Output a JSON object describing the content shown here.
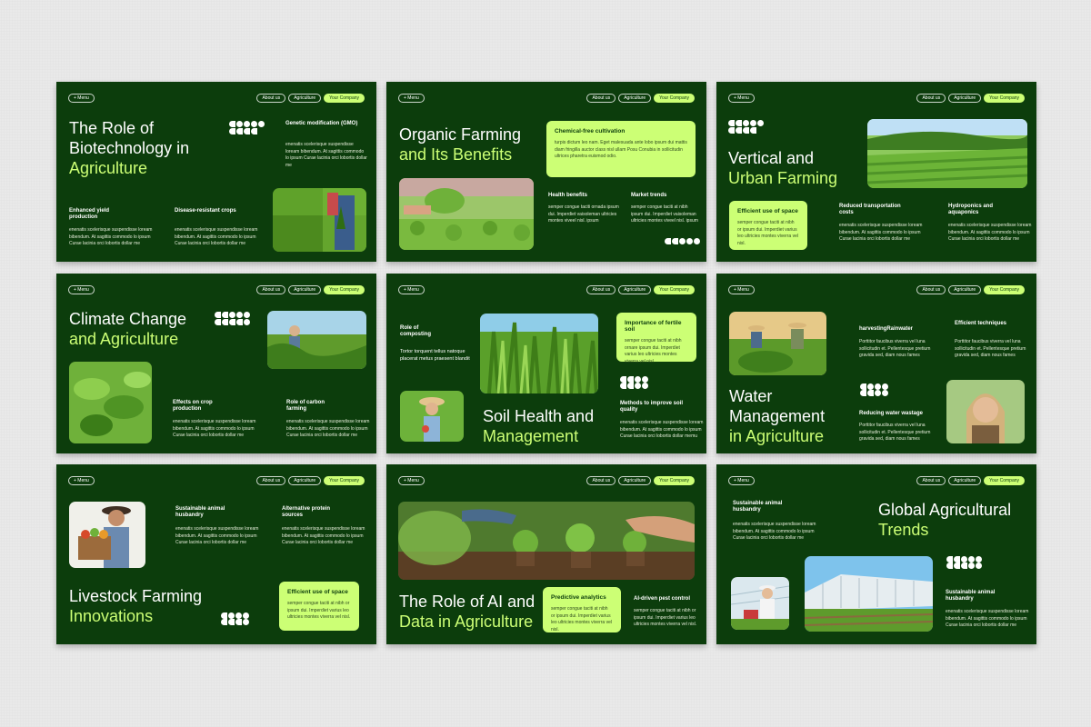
{
  "common": {
    "menu": "+ Menu",
    "nav": [
      "About us",
      "Agriculture",
      "Your Company"
    ]
  },
  "colors": {
    "slide_bg": "#0c3d0c",
    "accent": "#ccff75",
    "page_bg": "#e9e9e9"
  },
  "slides": [
    {
      "title": [
        "The Role of",
        "Biotechnology in"
      ],
      "title_accent": [
        "Agriculture"
      ],
      "gmo_heading": "Genetic modification (GMO)",
      "gmo_text": "enenatis scelerisque suspendisse loream bibendum. At sagittis commodo lo ipsum Curae lacinia orci lobortis dollar me",
      "yield_heading": "Enhanced yield production",
      "yield_text": "enenatis scelerisque suspendisse loream bibendum. At sagittis commodo lo ipsum Curae lacinia orci lobortis dollar me",
      "disease_heading": "Disease-resistant crops",
      "disease_text": "enenatis scelerisque suspendisse loream bibendum. At sagittis commodo lo ipsum Curae lacinia orci lobortis dollar me"
    },
    {
      "title": [
        "Organic Farming"
      ],
      "title_accent": [
        "and Its Benefits"
      ],
      "card_heading": "Chemical-free cultivation",
      "card_text": "turpis dictum leo nam. Eget malesuada ante lobo ipsum dui mattis diam fringilla auctor class nisl ullam Posu Conubia in sollicitudin ultrices pharetra euismod odio.",
      "health_heading": "Health benefits",
      "health_text": "semper congue taciti ornada ipsum dui. Imperdiet vaisoleman ultricies montes viveel nisl. ipsum",
      "market_heading": "Market trends",
      "market_text": "semper congue taciti at nibh ipsum dui. Imperdiet vaisoleman ultricies montes viveel nisl. ipsum"
    },
    {
      "title": [
        "Vertical and"
      ],
      "title_accent": [
        "Urban Farming"
      ],
      "card_heading": "Efficient use of space",
      "card_text": "semper congue taciti at nibh or ipsum dui. Imperdiet varius leo ultricies montes viverra vel nisl.",
      "transport_heading": "Reduced transportation costs",
      "transport_text": "enenatis scelerisque suspendisse loream bibendum. At sagittis commodo lo ipsum Curae lacinia orci lobortis dollar me",
      "hydro_heading": "Hydroponics and aquaponics",
      "hydro_text": "enenatis scelerisque suspendisse loream bibendum. At sagittis commodo lo ipsum Curae lacinia orci lobortis dollar me"
    },
    {
      "title": [
        "Climate Change"
      ],
      "title_accent": [
        "and Agriculture"
      ],
      "effects_heading": "Effects on crop production",
      "effects_text": "enenatis scelerisque suspendisse loream bibendum. At sagittis commodo lo ipsum Curae lacinia orci lobortis dollar me",
      "carbon_heading": "Role of carbon farming",
      "carbon_text": "enenatis scelerisque suspendisse loream bibendum. At sagittis commodo lo ipsum Curae lacinia orci lobortis dollar me"
    },
    {
      "title": [
        "Soil Health and"
      ],
      "title_accent": [
        "Management"
      ],
      "composting_heading": "Role of composting",
      "composting_text": "Tortor torquent tellus natoque placerat metus praesent blandit",
      "card_heading": "Importance of fertile soil",
      "card_text": "semper congue taciti at nibh ornare ipsum dui. Imperdiet varius leo ultricies montes viverra vel nisl.",
      "methods_heading": "Methods to improve soil quality",
      "methods_text": "enenatis scelerisque suspendisse loream bibendum. At sagittis commodo lo ipsum Curae lacinia orci lobortis dollar memu"
    },
    {
      "title": [
        "Water",
        "Management"
      ],
      "title_accent": [
        "in Agriculture"
      ],
      "harvest_heading": "harvestingRainwater",
      "harvest_text": "Porttitor faucibus viverra vel luna sollicitudin et. Pellentesque pretium gravida sed, diam nous fames",
      "efficient_heading": "Efficient techniques",
      "efficient_text": "Porttitor faucibus viverra vel luna sollicitudin et. Pellentesque pretium gravida sed, diam nous fames",
      "wastage_heading": "Reducing water wastage",
      "wastage_text": "Porttitor faucibus viverra vel luna sollicitudin et. Pellentesque pretium gravida sed, diam nous fames"
    },
    {
      "title": [
        "Livestock Farming"
      ],
      "title_accent": [
        "Innovations"
      ],
      "husbandry_heading": "Sustainable animal husbandry",
      "husbandry_text": "enenatis scelerisque suspendisse loream bibendum. At sagittis commodo lo ipsum Curae lacinia orci lobortis dollar me",
      "protein_heading": "Alternative protein sources",
      "protein_text": "enenatis scelerisque suspendisse loream bibendum. At sagittis commodo lo ipsum Curae lacinia orci lobortis dollar me",
      "card_heading": "Efficient use of space",
      "card_text": "semper congue taciti at nibh or ipsum dui. Imperdiet varius leo ultricies montes viverra vel nisl."
    },
    {
      "title": [
        "The Role of AI and"
      ],
      "title_accent": [
        "Data in Agriculture"
      ],
      "card_heading": "Predictive analytics",
      "card_text": "semper congue taciti at nibh or ipsum dui. Imperdiet varius leo ultricies montes viverra vel nisl.",
      "pest_heading": "AI-driven pest control",
      "pest_text": "semper congue taciti at nibh or ipsum dui. Imperdiet varius leo ultricies montes viverra vel nisl."
    },
    {
      "title": [
        "Global Agricultural"
      ],
      "title_accent": [
        "Trends"
      ],
      "husbandry_heading": "Sustainable animal husbandry",
      "husbandry_text": "enenatis scelerisque suspendisse loream bibendum. At sagittis commodo lo ipsum Curae lacinia orci lobortis dollar me",
      "husbandry2_heading": "Sustainable animal husbandry",
      "husbandry2_text": "enenatis scelerisque suspendisse loream bibendum. At sagittis commodo lo ipsum Curae lacinia orci lobortis dollar me"
    }
  ]
}
